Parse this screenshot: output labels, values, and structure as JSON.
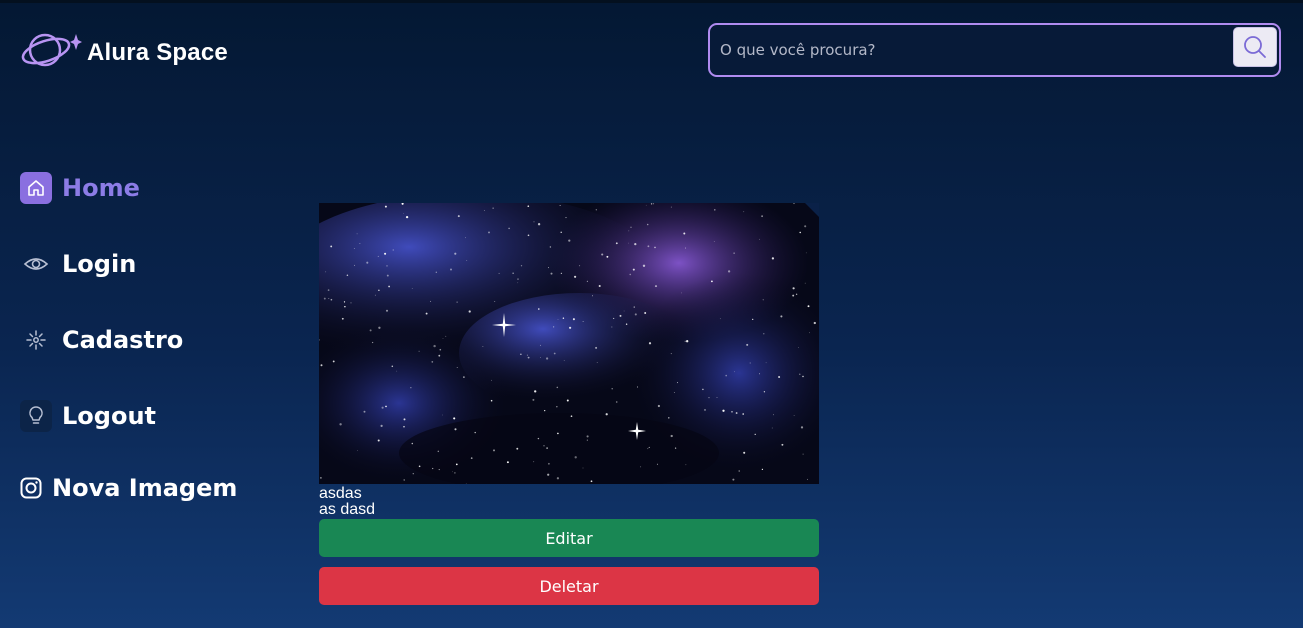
{
  "brand": {
    "name": "Alura Space"
  },
  "search": {
    "placeholder": "O que você procura?",
    "value": ""
  },
  "nav": {
    "items": [
      {
        "label": "Home",
        "icon": "home-icon",
        "active": true
      },
      {
        "label": "Login",
        "icon": "eye-icon",
        "active": false
      },
      {
        "label": "Cadastro",
        "icon": "sparkle-icon",
        "active": false
      },
      {
        "label": "Logout",
        "icon": "lightbulb-icon",
        "active": false
      },
      {
        "label": "Nova Imagem",
        "icon": "instagram-icon",
        "active": false
      }
    ]
  },
  "card": {
    "title": "asdas",
    "description": "as dasd",
    "edit_label": "Editar",
    "delete_label": "Deletar"
  },
  "colors": {
    "accent": "#8c7ce6",
    "search_border": "#b08bf0",
    "edit": "#198754",
    "delete": "#dc3545"
  }
}
